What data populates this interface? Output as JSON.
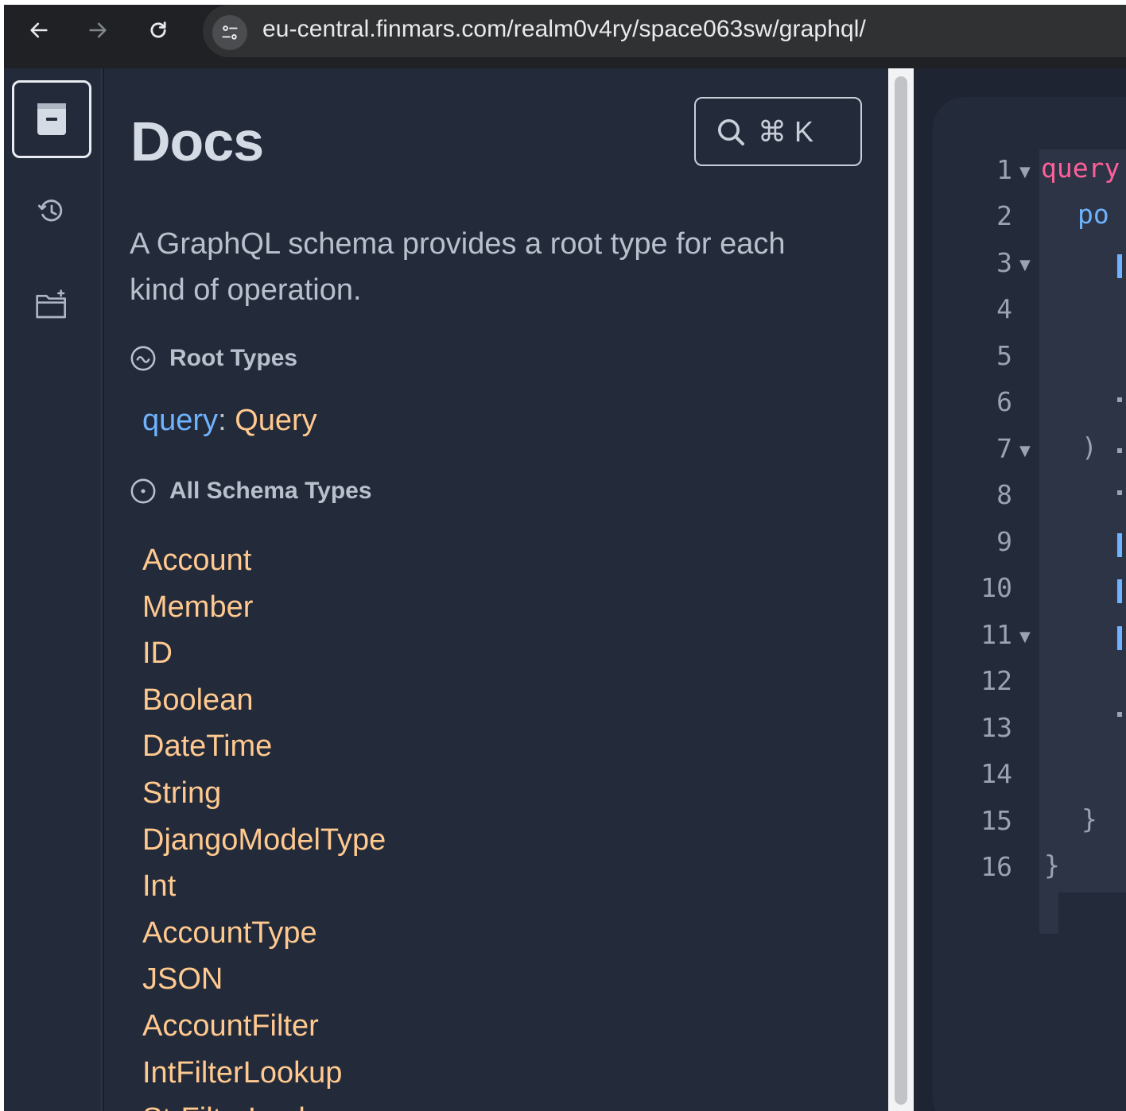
{
  "browser": {
    "url": "eu-central.finmars.com/realm0v4ry/space063sw/graphql/",
    "back_icon": "arrow-left-icon",
    "forward_icon": "arrow-right-icon",
    "reload_icon": "reload-icon",
    "site_info_icon": "tune-icon"
  },
  "sidebar": {
    "items": [
      {
        "name": "docs",
        "icon": "book-icon",
        "active": true
      },
      {
        "name": "history",
        "icon": "history-icon",
        "active": false
      },
      {
        "name": "collections",
        "icon": "folder-plus-icon",
        "active": false
      }
    ]
  },
  "docs": {
    "title": "Docs",
    "search_shortcut": "⌘ K",
    "description": "A GraphQL schema provides a root type for each kind of operation.",
    "root_types_label": "Root Types",
    "root_query_field": "query",
    "root_query_colon": ":",
    "root_query_type": "Query",
    "all_schema_types_label": "All Schema Types",
    "types": [
      "Account",
      "Member",
      "ID",
      "Boolean",
      "DateTime",
      "String",
      "DjangoModelType",
      "Int",
      "AccountType",
      "JSON",
      "AccountFilter",
      "IntFilterLookup",
      "StrFilterLookup"
    ]
  },
  "editor": {
    "line_numbers": [
      "1",
      "2",
      "3",
      "4",
      "5",
      "6",
      "7",
      "8",
      "9",
      "10",
      "11",
      "12",
      "13",
      "14",
      "15",
      "16"
    ],
    "folded_lines": [
      "1",
      "3",
      "7",
      "11"
    ],
    "code": {
      "line1": "query",
      "line2": "po",
      "line7": ")",
      "line15": "}",
      "line16": "}"
    },
    "colors": {
      "keyword": "#ff5f9a",
      "field": "#6fb3ff",
      "punctuation": "#9aa3b2"
    }
  },
  "colors": {
    "accent_type": "#ffc98f",
    "accent_field": "#6fb3ff",
    "panel_bg": "#232a3a"
  }
}
